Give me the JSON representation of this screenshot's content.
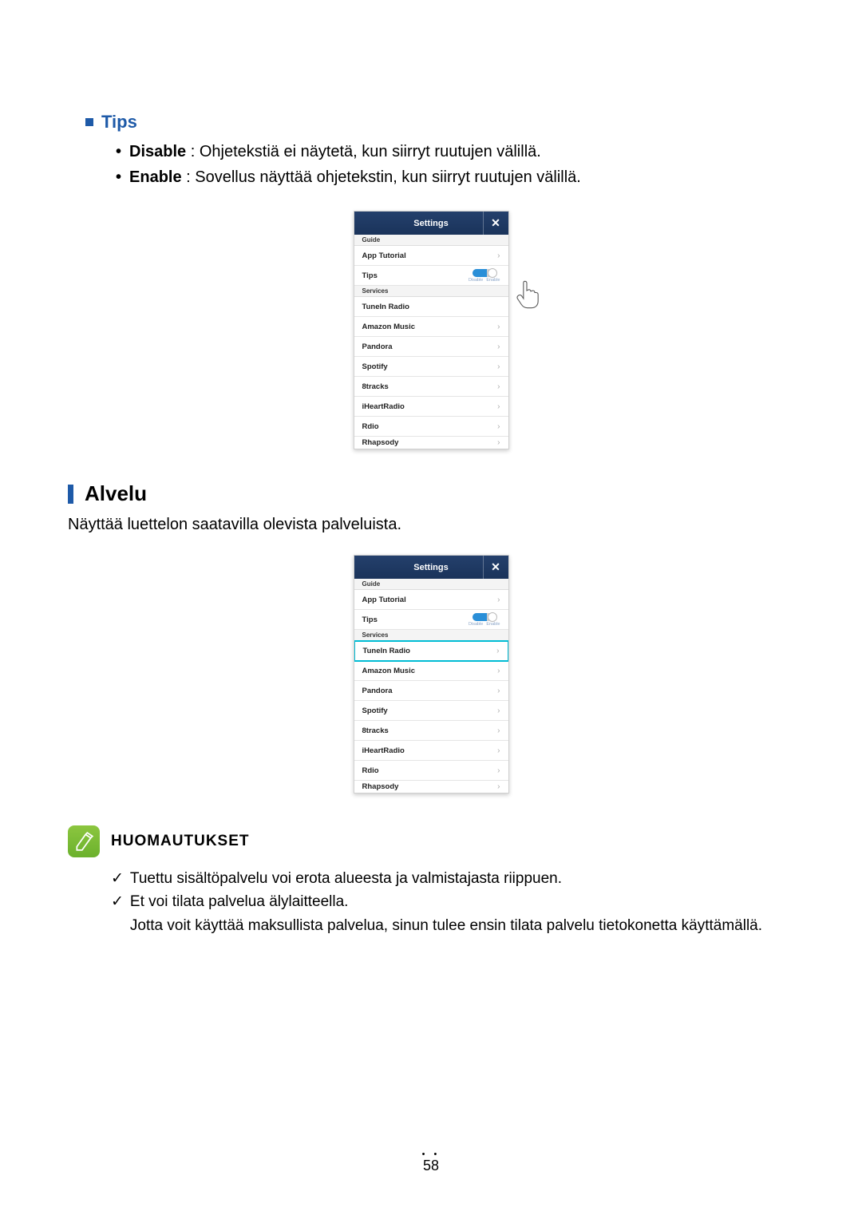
{
  "tips": {
    "title": "Tips",
    "items": [
      {
        "bold": "Disable",
        "rest": " : Ohjetekstiä ei näytetä, kun siirryt ruutujen välillä."
      },
      {
        "bold": "Enable",
        "rest": " : Sovellus näyttää ohjetekstin, kun siirryt ruutujen välillä."
      }
    ]
  },
  "phone1": {
    "title": "Settings",
    "close": "✕",
    "sectionGuide": "Guide",
    "sectionServices": "Services",
    "appTutorial": "App Tutorial",
    "tips": "Tips",
    "toggle": {
      "left": "Disable",
      "right": "Enable"
    },
    "services": [
      "TuneIn Radio",
      "Amazon Music",
      "Pandora",
      "Spotify",
      "8tracks",
      "iHeartRadio",
      "Rdio",
      "Rhapsody"
    ]
  },
  "alvelu": {
    "title": "Alvelu",
    "desc": "Näyttää luettelon saatavilla olevista palveluista."
  },
  "phone2": {
    "title": "Settings",
    "close": "✕",
    "sectionGuide": "Guide",
    "sectionServices": "Services",
    "appTutorial": "App Tutorial",
    "tips": "Tips",
    "toggle": {
      "left": "Disable",
      "right": "Enable"
    },
    "services": [
      "TuneIn Radio",
      "Amazon Music",
      "Pandora",
      "Spotify",
      "8tracks",
      "iHeartRadio",
      "Rdio",
      "Rhapsody"
    ]
  },
  "notes": {
    "title": "HUOMAUTUKSET",
    "items": [
      {
        "lines": [
          "Tuettu sisältöpalvelu voi erota alueesta ja valmistajasta riippuen."
        ]
      },
      {
        "lines": [
          "Et voi tilata palvelua älylaitteella.",
          "Jotta voit käyttää maksullista palvelua, sinun tulee ensin tilata palvelu tietokonetta käyttämällä."
        ]
      }
    ]
  },
  "pageNumber": "58"
}
